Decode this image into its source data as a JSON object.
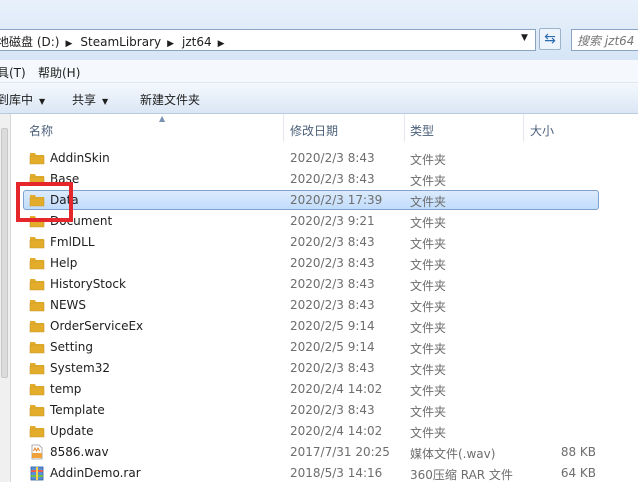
{
  "address": {
    "crumbs": [
      "地磁盘 (D:)",
      "SteamLibrary",
      "jzt64"
    ],
    "search_placeholder": "搜索 jzt64"
  },
  "menu": {
    "items": [
      "具(T)",
      "帮助(H)"
    ]
  },
  "toolbar": {
    "buttons": [
      "到库中",
      "共享",
      "新建文件夹"
    ]
  },
  "columns": {
    "name": "名称",
    "date": "修改日期",
    "type": "类型",
    "size": "大小"
  },
  "files": [
    {
      "name": "AddinSkin",
      "date": "2020/2/3 8:43",
      "type": "文件夹",
      "size": "",
      "icon": "folder-icon"
    },
    {
      "name": "Base",
      "date": "2020/2/3 8:43",
      "type": "文件夹",
      "size": "",
      "icon": "folder-icon"
    },
    {
      "name": "Data",
      "date": "2020/2/3 17:39",
      "type": "文件夹",
      "size": "",
      "icon": "folder-icon",
      "selected": true
    },
    {
      "name": "Document",
      "date": "2020/2/3 9:21",
      "type": "文件夹",
      "size": "",
      "icon": "folder-icon"
    },
    {
      "name": "FmlDLL",
      "date": "2020/2/3 8:43",
      "type": "文件夹",
      "size": "",
      "icon": "folder-icon"
    },
    {
      "name": "Help",
      "date": "2020/2/3 8:43",
      "type": "文件夹",
      "size": "",
      "icon": "folder-icon"
    },
    {
      "name": "HistoryStock",
      "date": "2020/2/3 8:43",
      "type": "文件夹",
      "size": "",
      "icon": "folder-icon"
    },
    {
      "name": "NEWS",
      "date": "2020/2/3 8:43",
      "type": "文件夹",
      "size": "",
      "icon": "folder-icon"
    },
    {
      "name": "OrderServiceEx",
      "date": "2020/2/5 9:14",
      "type": "文件夹",
      "size": "",
      "icon": "folder-icon"
    },
    {
      "name": "Setting",
      "date": "2020/2/5 9:14",
      "type": "文件夹",
      "size": "",
      "icon": "folder-icon"
    },
    {
      "name": "System32",
      "date": "2020/2/3 8:43",
      "type": "文件夹",
      "size": "",
      "icon": "folder-icon"
    },
    {
      "name": "temp",
      "date": "2020/2/4 14:02",
      "type": "文件夹",
      "size": "",
      "icon": "folder-icon"
    },
    {
      "name": "Template",
      "date": "2020/2/3 8:43",
      "type": "文件夹",
      "size": "",
      "icon": "folder-icon"
    },
    {
      "name": "Update",
      "date": "2020/2/4 14:02",
      "type": "文件夹",
      "size": "",
      "icon": "folder-icon"
    },
    {
      "name": "8586.wav",
      "date": "2017/7/31 20:25",
      "type": "媒体文件(.wav)",
      "size": "88 KB",
      "icon": "wav-file-icon"
    },
    {
      "name": "AddinDemo.rar",
      "date": "2018/5/3 14:16",
      "type": "360压缩 RAR 文件",
      "size": "64 KB",
      "icon": "rar-file-icon"
    }
  ]
}
